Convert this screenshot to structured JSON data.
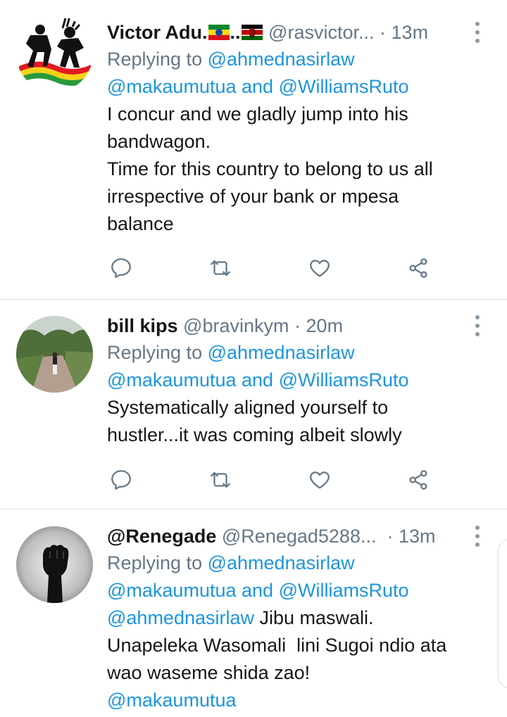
{
  "tweets": [
    {
      "name": "Victor Adu.",
      "name_mid": "..",
      "handle": "@rasvictor...",
      "time": "13m",
      "reply_prefix": "Replying to",
      "reply_to_1": "@ahmednasirlaw",
      "reply_to_2": "@makaumutua",
      "reply_and": "and",
      "reply_to_3": "@WilliamsRuto",
      "text_lines": [
        "I concur and we gladly jump into his",
        "bandwagon.",
        "Time for this country to belong to us all",
        "irrespective of your bank or mpesa",
        "balance"
      ],
      "avatar": "dancers-logo-avatar"
    },
    {
      "name": "bill kips",
      "handle": "@bravinkym",
      "time": "20m",
      "reply_prefix": "Replying to",
      "reply_to_1": "@ahmednasirlaw",
      "reply_to_2": "@makaumutua",
      "reply_and": "and",
      "reply_to_3": "@WilliamsRuto",
      "text_lines": [
        "Systematically aligned yourself to",
        "hustler...it was coming albeit slowly"
      ],
      "avatar": "runner-photo-avatar"
    },
    {
      "name": "@Renegade",
      "handle": "@Renegad5288...",
      "time": "13m",
      "reply_prefix": "Replying to",
      "reply_to_1": "@ahmednasirlaw",
      "reply_to_2": "@makaumutua",
      "reply_and": "and",
      "reply_to_3": "@WilliamsRuto",
      "body_mention_1": "@ahmednasirlaw",
      "body_text_1": " Jibu maswali.",
      "text_lines": [
        "Unapeleka Wasomali  lini Sugoi ndio ata",
        "wao waseme shida zao!"
      ],
      "body_mention_2": "@makaumutua",
      "avatar": "raised-fist-avatar"
    }
  ],
  "icons": [
    "reply-icon",
    "retweet-icon",
    "like-icon",
    "share-icon",
    "more-options-icon"
  ],
  "colors": {
    "link": "#1b95e0",
    "secondary": "#657786",
    "icon": "#657786",
    "divider": "#dfe4e8"
  }
}
